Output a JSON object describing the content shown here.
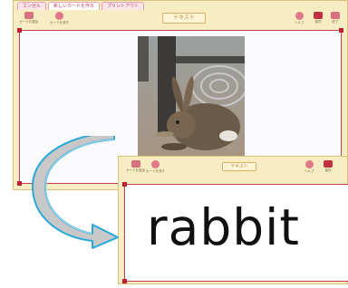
{
  "window1": {
    "tabs": [
      "エンゼル",
      "新しいカードを作る",
      "プリントアウト"
    ],
    "toolbar": {
      "left_buttons": [
        "カードを追加",
        "カードを消す"
      ],
      "mode_label": "テキスト",
      "right_buttons": [
        "ヘルプ",
        "保存",
        "終了"
      ]
    },
    "image": {
      "subject": "rabbit photo",
      "description_hidden": ""
    }
  },
  "window2": {
    "toolbar": {
      "left_buttons": [
        "カードを追加",
        "カードを消す"
      ],
      "mode_label": "テキスト",
      "right_buttons": [
        "ヘルプ",
        "保存"
      ]
    },
    "card_text": "rabbit"
  },
  "colors": {
    "frame_red": "#c04050",
    "toolbar_bg": "#f7ecc2",
    "arrow_fill": "#c8c8c8",
    "arrow_stroke": "#2aa8d8"
  },
  "icons": [
    "transition-arrow-icon",
    "rabbit-photo"
  ]
}
